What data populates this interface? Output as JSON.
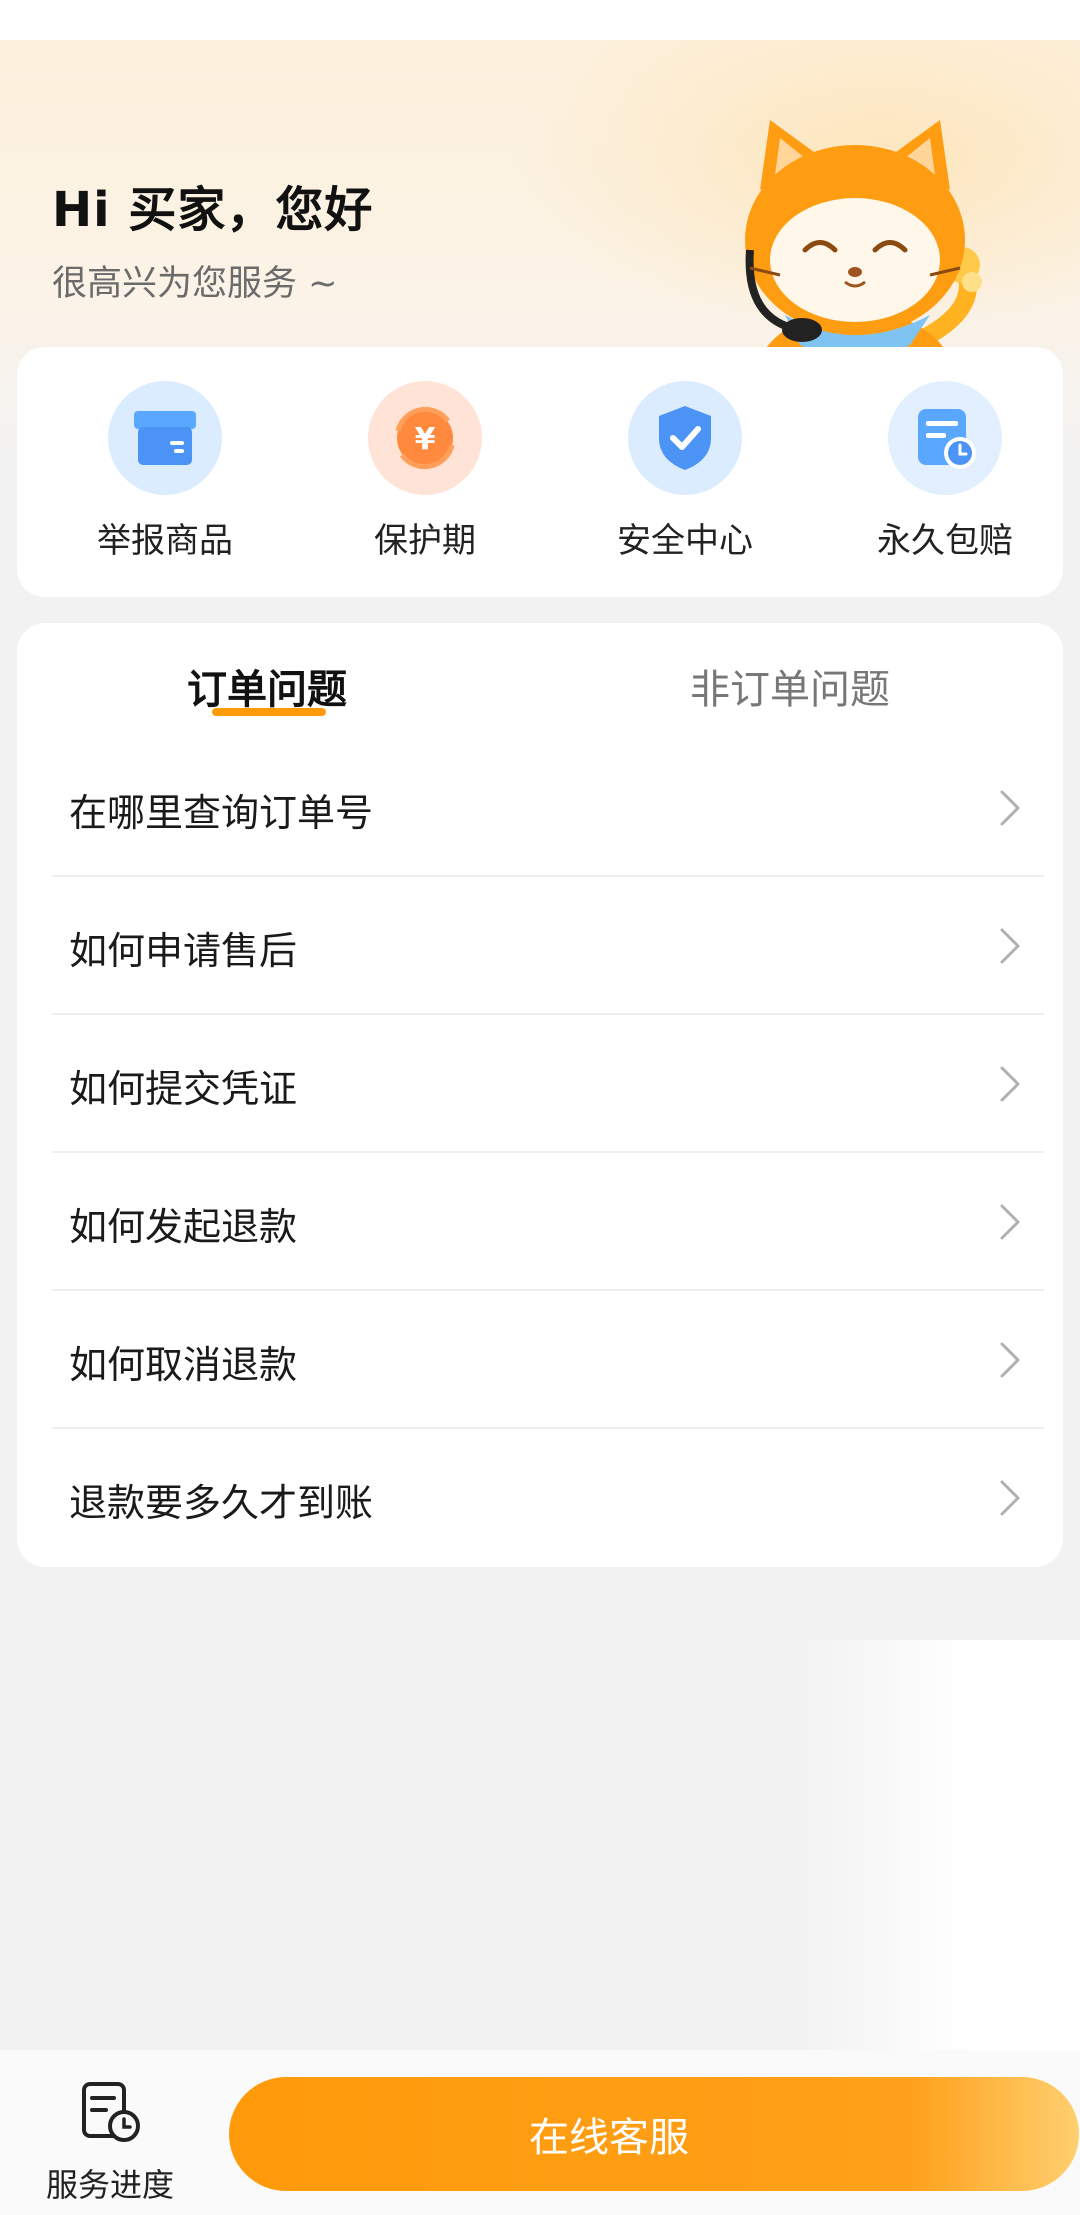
{
  "header": {
    "greeting": "Hi 买家，您好",
    "subtitle": "很高兴为您服务 ~"
  },
  "quick_actions": [
    {
      "label": "举报商品",
      "icon": "box-icon"
    },
    {
      "label": "保护期",
      "icon": "yuan-refresh-icon"
    },
    {
      "label": "安全中心",
      "icon": "shield-check-icon"
    },
    {
      "label": "永久包赔",
      "icon": "document-clock-icon"
    }
  ],
  "tabs": [
    {
      "label": "订单问题",
      "active": true
    },
    {
      "label": "非订单问题",
      "active": false
    }
  ],
  "faq": [
    "在哪里查询订单号",
    "如何申请售后",
    "如何提交凭证",
    "如何发起退款",
    "如何取消退款",
    "退款要多久才到账"
  ],
  "bottom": {
    "progress_label": "服务进度",
    "cs_button": "在线客服"
  },
  "colors": {
    "accent": "#ff9a0a",
    "background": "#f3f2f2",
    "card": "#ffffff"
  }
}
